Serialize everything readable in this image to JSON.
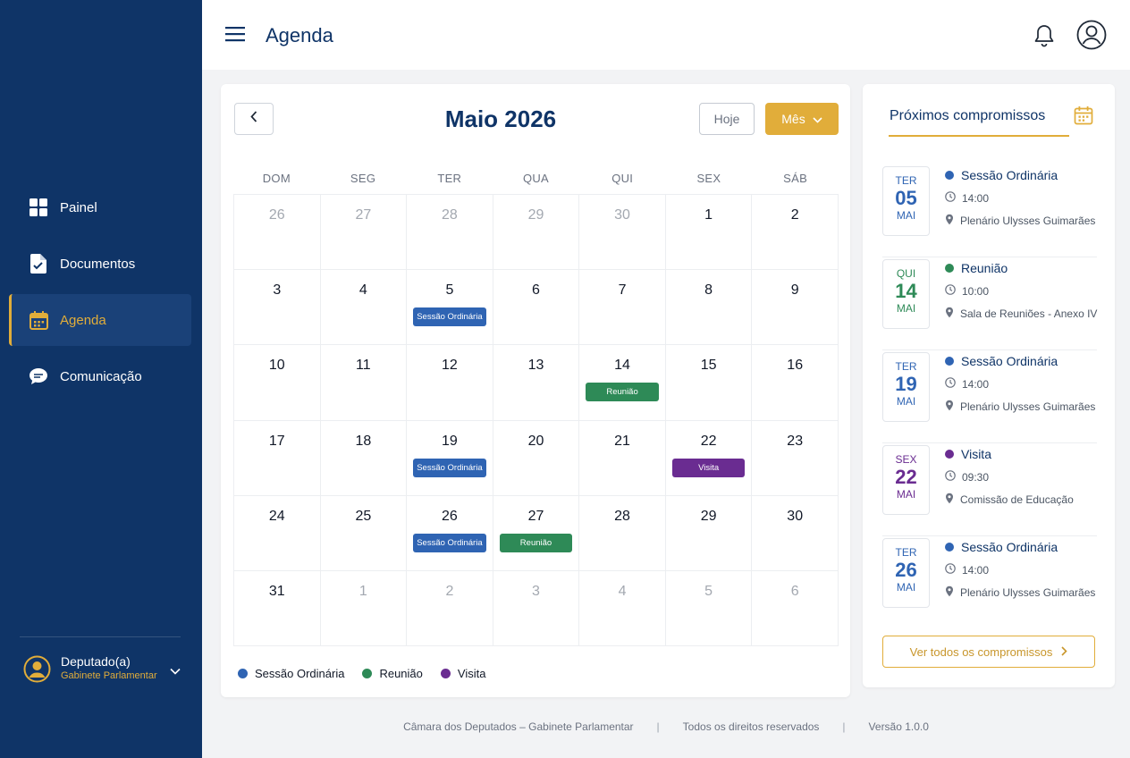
{
  "sidebar": {
    "items": [
      {
        "label": "Painel",
        "icon": "dashboard-icon"
      },
      {
        "label": "Documentos",
        "icon": "document-icon"
      },
      {
        "label": "Agenda",
        "icon": "calendar-icon",
        "active": true
      },
      {
        "label": "Comunicação",
        "icon": "chat-icon"
      }
    ],
    "user": {
      "name": "Deputado(a)",
      "role": "Gabinete Parlamentar"
    }
  },
  "header": {
    "title": "Agenda"
  },
  "calendar": {
    "month_label": "Maio 2026",
    "today_label": "Hoje",
    "view_label": "Mês",
    "weekdays": [
      "DOM",
      "SEG",
      "TER",
      "QUA",
      "QUI",
      "SEX",
      "SÁB"
    ],
    "days": [
      {
        "d": "26",
        "muted": true
      },
      {
        "d": "27",
        "muted": true
      },
      {
        "d": "28",
        "muted": true
      },
      {
        "d": "29",
        "muted": true
      },
      {
        "d": "30",
        "muted": true
      },
      {
        "d": "1"
      },
      {
        "d": "2"
      },
      {
        "d": "3"
      },
      {
        "d": "4"
      },
      {
        "d": "5",
        "event": "Sessão Ordinária",
        "type": "sessao"
      },
      {
        "d": "6"
      },
      {
        "d": "7"
      },
      {
        "d": "8"
      },
      {
        "d": "9"
      },
      {
        "d": "10"
      },
      {
        "d": "11"
      },
      {
        "d": "12"
      },
      {
        "d": "13"
      },
      {
        "d": "14",
        "event": "Reunião",
        "type": "reuniao"
      },
      {
        "d": "15"
      },
      {
        "d": "16"
      },
      {
        "d": "17"
      },
      {
        "d": "18"
      },
      {
        "d": "19",
        "event": "Sessão Ordinária",
        "type": "sessao"
      },
      {
        "d": "20"
      },
      {
        "d": "21"
      },
      {
        "d": "22",
        "event": "Visita",
        "type": "visita"
      },
      {
        "d": "23"
      },
      {
        "d": "24"
      },
      {
        "d": "25"
      },
      {
        "d": "26",
        "event": "Sessão Ordinária",
        "type": "sessao"
      },
      {
        "d": "27",
        "event": "Reunião",
        "type": "reuniao"
      },
      {
        "d": "28"
      },
      {
        "d": "29"
      },
      {
        "d": "30"
      },
      {
        "d": "31"
      },
      {
        "d": "1",
        "muted": true
      },
      {
        "d": "2",
        "muted": true
      },
      {
        "d": "3",
        "muted": true
      },
      {
        "d": "4",
        "muted": true
      },
      {
        "d": "5",
        "muted": true
      },
      {
        "d": "6",
        "muted": true
      }
    ],
    "legend": [
      {
        "label": "Sessão Ordinária",
        "type": "sessao"
      },
      {
        "label": "Reunião",
        "type": "reuniao"
      },
      {
        "label": "Visita",
        "type": "visita"
      }
    ]
  },
  "colors": {
    "sessao": "#2f64b3",
    "reuniao": "#2e8a57",
    "visita": "#6a2c91",
    "accent": "#e1ad3a",
    "primary": "#0f3467"
  },
  "upcoming": {
    "title": "Próximos compromissos",
    "items": [
      {
        "weekday": "TER",
        "day": "05",
        "month": "MAI",
        "title": "Sessão Ordinária",
        "type": "sessao",
        "time": "14:00",
        "place": "Plenário Ulysses Guimarães"
      },
      {
        "weekday": "QUI",
        "day": "14",
        "month": "MAI",
        "title": "Reunião",
        "type": "reuniao",
        "time": "10:00",
        "place": "Sala de Reuniões - Anexo IV"
      },
      {
        "weekday": "TER",
        "day": "19",
        "month": "MAI",
        "title": "Sessão Ordinária",
        "type": "sessao",
        "time": "14:00",
        "place": "Plenário Ulysses Guimarães"
      },
      {
        "weekday": "SEX",
        "day": "22",
        "month": "MAI",
        "title": "Visita",
        "type": "visita",
        "time": "09:30",
        "place": "Comissão de Educação"
      },
      {
        "weekday": "TER",
        "day": "26",
        "month": "MAI",
        "title": "Sessão Ordinária",
        "type": "sessao",
        "time": "14:00",
        "place": "Plenário Ulysses Guimarães"
      }
    ],
    "see_all": "Ver todos os compromissos"
  },
  "footer": {
    "org": "Câmara dos Deputados – Gabinete Parlamentar",
    "rights": "Todos os direitos reservados",
    "version": "Versão 1.0.0"
  }
}
